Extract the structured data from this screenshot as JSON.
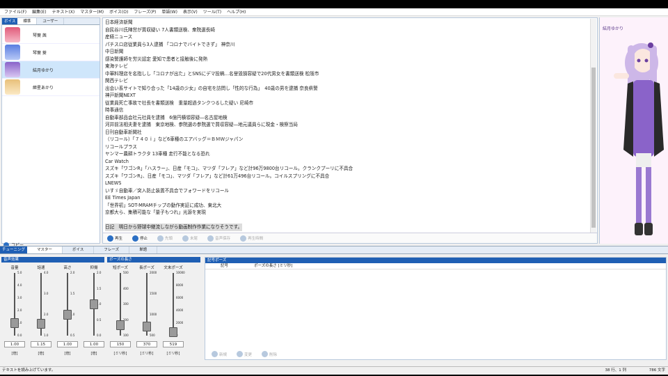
{
  "menu": [
    "ファイル(F)",
    "編集(E)",
    "テキスト(X)",
    "マスター(M)",
    "ボイス(O)",
    "フレーズ(P)",
    "単語(W)",
    "表示(V)",
    "ツール(T)",
    "ヘルプ(H)"
  ],
  "voice_panel": {
    "badge": "ボイス",
    "tabs": [
      "標準",
      "ユーザー"
    ],
    "characters": [
      {
        "name": "琴葉 茜",
        "color": "#e05a7a"
      },
      {
        "name": "琴葉 葵",
        "color": "#5a7ee0"
      },
      {
        "name": "結月ゆかり",
        "color": "#8a63c9"
      },
      {
        "name": "紲星あかり",
        "color": "#e8c07a"
      }
    ],
    "copy_label": "コピー"
  },
  "text_lines": [
    "日本経済新聞",
    "自民谷川氏陣営が買収疑い 7人書類送検、衆院選長崎",
    "産経ニュース",
    "パチスロ店従業員ら3人逮捕 「コロナでバイトできず」 神奈川",
    "中日新聞",
    "感染警護師を労災認定 愛知で患者と接触後に発熱",
    "東海テレビ",
    "中華料理店を名指しし「コロナが出た」とSNSにデマ投稿…名誉毀損容疑で20代男女を書類送検 松阪市",
    "関西テレビ",
    "出会い系サイトで知り合った「14歳の少女」の自宅を訪問し「性的な行為」　40歳の男を逮捕 奈良県警",
    "神戸新聞NEXT",
    "従業員死亡事故で社長を書類送検　重量超過タンクつるした疑い 尼崎市",
    "時事通信",
    "自動車部品会社元社員を逮捕　6億円横領容疑―名古屋地検",
    "河井前法相夫妻を逮捕　東京地検、参院選の参院選で買収容疑―地元議員らに現金・検察当局",
    "日刊自動車新聞社",
    "（リコール）「７４０ｉ」など6車種のエアバッグ＝ＢＭＷジャパン",
    "リコールプラス",
    "ヤンマー農耕トラクタ 13車種 走行不能となる恐れ",
    "Car Watch",
    "スズキ「ワゴンR」「ハスラー」、日産「モコ」、マツダ「フレア」など計96万9800台リコール。クランクプーリに不具合",
    "スズキ「ワゴンR」、日産「モコ」、マツダ「フレア」など計61万496台リコール。コイルスプリングに不具合",
    "LNEWS",
    "いすゞ自動車／突入防止装置不具合でフォワードをリコール",
    "EE Times Japan",
    "「世界初」SOT-MRAMチップの動作実証に成功、東北大",
    "京都大ら、集積可能な「量子もつれ」光源を実現",
    "",
    "日記　明日から野球中継流しながら動画制作作業になりそうです。"
  ],
  "playback": [
    {
      "label": "再生",
      "enabled": true
    },
    {
      "label": "停止",
      "enabled": true
    },
    {
      "label": "先頭",
      "enabled": false
    },
    {
      "label": "末尾",
      "enabled": false
    },
    {
      "label": "音声保存",
      "enabled": false
    },
    {
      "label": "再生時間",
      "enabled": false
    }
  ],
  "character_name": "結月ゆかり",
  "bottom_tabs": {
    "badge": "チューニング",
    "tabs": [
      "マスター",
      "ボイス",
      "フレーズ",
      "単語"
    ]
  },
  "sections": {
    "effects": "音声効果",
    "pause": "ポーズの長さ",
    "symbol_pause": "記号ポーズ"
  },
  "sliders": [
    {
      "label": "音量",
      "value": "1.00",
      "display": "1.00",
      "unit": "[倍]",
      "min": 0,
      "max": 5,
      "ticks": [
        "5.0",
        "4.0",
        "3.0",
        "2.0",
        "1.0",
        "0.0"
      ]
    },
    {
      "label": "話速",
      "value": "1.15",
      "display": "1.15",
      "unit": "[倍]",
      "min": 0.5,
      "max": 4,
      "ticks": [
        "4.0",
        "3.0",
        "2.0",
        "1.0"
      ]
    },
    {
      "label": "高さ",
      "value": "1.00",
      "display": "1.00",
      "unit": "[倍]",
      "min": 0.5,
      "max": 2,
      "ticks": [
        "2.0",
        "1.5",
        "1.0",
        "0.5"
      ]
    },
    {
      "label": "抑揚",
      "value": "1.00",
      "display": "1.00",
      "unit": "[倍]",
      "min": 0,
      "max": 2,
      "ticks": [
        "2.0",
        "1.5",
        "1.0",
        "0.5",
        "0.0"
      ]
    },
    {
      "label": "短ポーズ",
      "value": "150",
      "display": "150",
      "unit": "[ミリ秒]",
      "min": 80,
      "max": 500,
      "ticks": [
        "500",
        "400",
        "300",
        "200",
        "100"
      ]
    },
    {
      "label": "長ポーズ",
      "value": "370",
      "display": "370",
      "unit": "[ミリ秒]",
      "min": 100,
      "max": 2000,
      "ticks": [
        "2000",
        "1500",
        "1000",
        "500"
      ]
    },
    {
      "label": "文末ポーズ",
      "value": "519",
      "display": "519",
      "unit": "[ミリ秒]",
      "min": 0,
      "max": 10000,
      "ticks": [
        "10000",
        "8000",
        "6000",
        "4000",
        "2000",
        "0"
      ]
    }
  ],
  "pause_table": {
    "headers": [
      "記号",
      "ポーズの長さ [ミリ秒]"
    ]
  },
  "pause_actions": [
    "新規",
    "変更",
    "削除"
  ],
  "status": {
    "message": "テキストを読み上げています。",
    "position": "38 行、1 列",
    "chars": "786 文字"
  }
}
